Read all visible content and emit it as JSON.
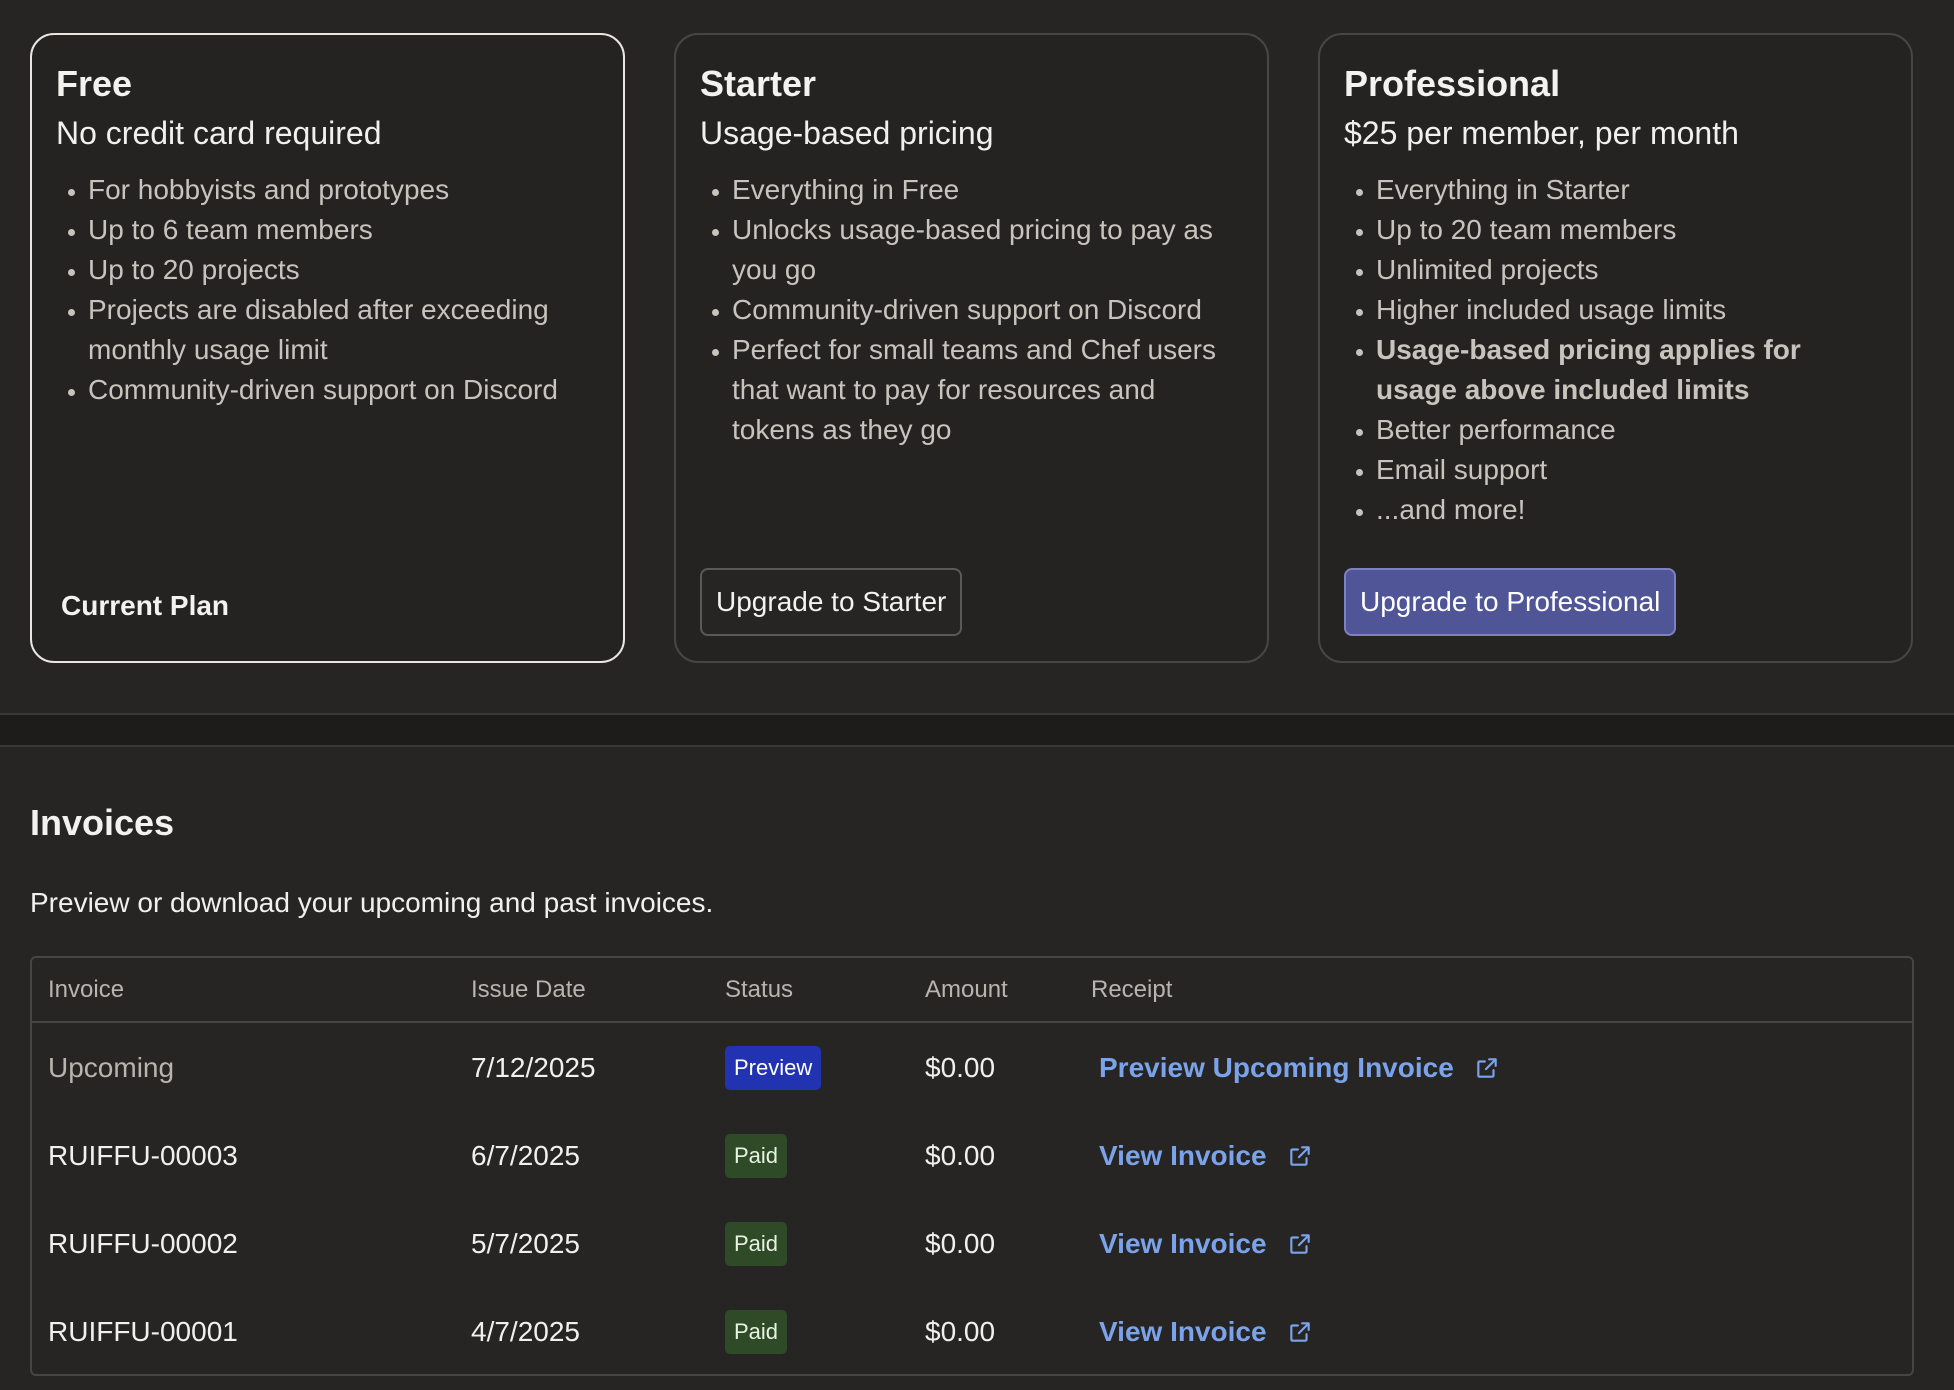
{
  "plans": [
    {
      "name": "Free",
      "subtitle": "No credit card required",
      "features": [
        "For hobbyists and prototypes",
        "Up to 6 team members",
        "Up to 20 projects",
        "Projects are disabled after exceeding monthly usage limit",
        "Community-driven support on Discord"
      ],
      "current_label": "Current Plan"
    },
    {
      "name": "Starter",
      "subtitle": "Usage-based pricing",
      "features": [
        "Everything in Free",
        "Unlocks usage-based pricing to pay as you go",
        "Community-driven support on Discord",
        "Perfect for small teams and Chef users that want to pay for resources and tokens as they go"
      ],
      "button_label": "Upgrade to Starter"
    },
    {
      "name": "Professional",
      "subtitle": "$25 per member, per month",
      "features": [
        "Everything in Starter",
        "Up to 20 team members",
        "Unlimited projects",
        "Higher included usage limits",
        "Usage-based pricing applies for usage above included limits",
        "Better performance",
        "Email support",
        "...and more!"
      ],
      "button_label": "Upgrade to Professional"
    }
  ],
  "invoices": {
    "title": "Invoices",
    "description": "Preview or download your upcoming and past invoices.",
    "columns": [
      "Invoice",
      "Issue Date",
      "Status",
      "Amount",
      "Receipt"
    ],
    "rows": [
      {
        "invoice": "Upcoming",
        "date": "7/12/2025",
        "status": "Preview",
        "amount": "$0.00",
        "receipt": "Preview Upcoming Invoice"
      },
      {
        "invoice": "RUIFFU-00003",
        "date": "6/7/2025",
        "status": "Paid",
        "amount": "$0.00",
        "receipt": "View Invoice"
      },
      {
        "invoice": "RUIFFU-00002",
        "date": "5/7/2025",
        "status": "Paid",
        "amount": "$0.00",
        "receipt": "View Invoice"
      },
      {
        "invoice": "RUIFFU-00001",
        "date": "4/7/2025",
        "status": "Paid",
        "amount": "$0.00",
        "receipt": "View Invoice"
      }
    ]
  },
  "colors": {
    "background": "#262524",
    "primary_button": "#4f5596",
    "link": "#7aa3ea",
    "badge_preview": "#2233b2",
    "badge_paid": "#2e4a27"
  },
  "icons": {
    "receipt_link": "external-link-icon"
  }
}
